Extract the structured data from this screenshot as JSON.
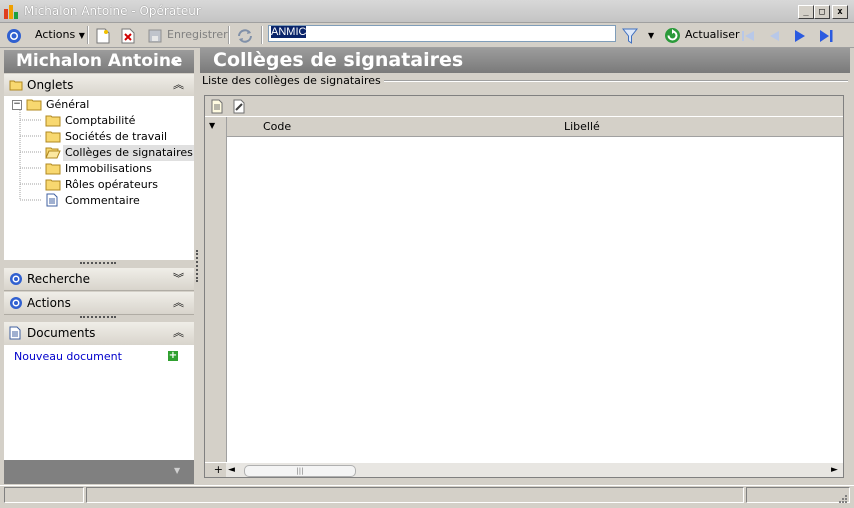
{
  "window": {
    "title": "Michalon Antoine - Opérateur",
    "buttons": {
      "minimize": "_",
      "maximize": "□",
      "close": "x"
    }
  },
  "toolbar": {
    "actions_label": "Actions",
    "save_label": "Enregistrer",
    "search_value": "ANMIC",
    "refresh_label": "Actualiser"
  },
  "left": {
    "header": "Michalon Antoine",
    "collapse_glyph": "«",
    "onglets": "Onglets",
    "tree": {
      "root": "Général",
      "items": [
        "Comptabilité",
        "Sociétés de travail",
        "Collèges de signataires",
        "Immobilisations",
        "Rôles opérateurs",
        "Commentaire"
      ],
      "selected_index": 2
    },
    "recherche": "Recherche",
    "actions": "Actions",
    "documents": "Documents",
    "new_document": "Nouveau document"
  },
  "main": {
    "title": "Collèges de signataires",
    "group_label": "Liste des collèges de signataires",
    "columns": [
      "Code",
      "Libellé"
    ],
    "add_glyph": "+"
  },
  "colors": {
    "header_bg": "#8a8a8a",
    "selection": "#0a246a",
    "link": "#0000cc",
    "accent_icon": "#2050c0"
  },
  "icons": [
    "app-icon",
    "actions-icon",
    "new-icon",
    "delete-icon",
    "save-icon",
    "sync-icon",
    "filter-icon",
    "refresh-icon",
    "first-icon",
    "previous-icon",
    "next-icon",
    "last-icon",
    "folder-icon",
    "document-icon",
    "add-icon"
  ]
}
